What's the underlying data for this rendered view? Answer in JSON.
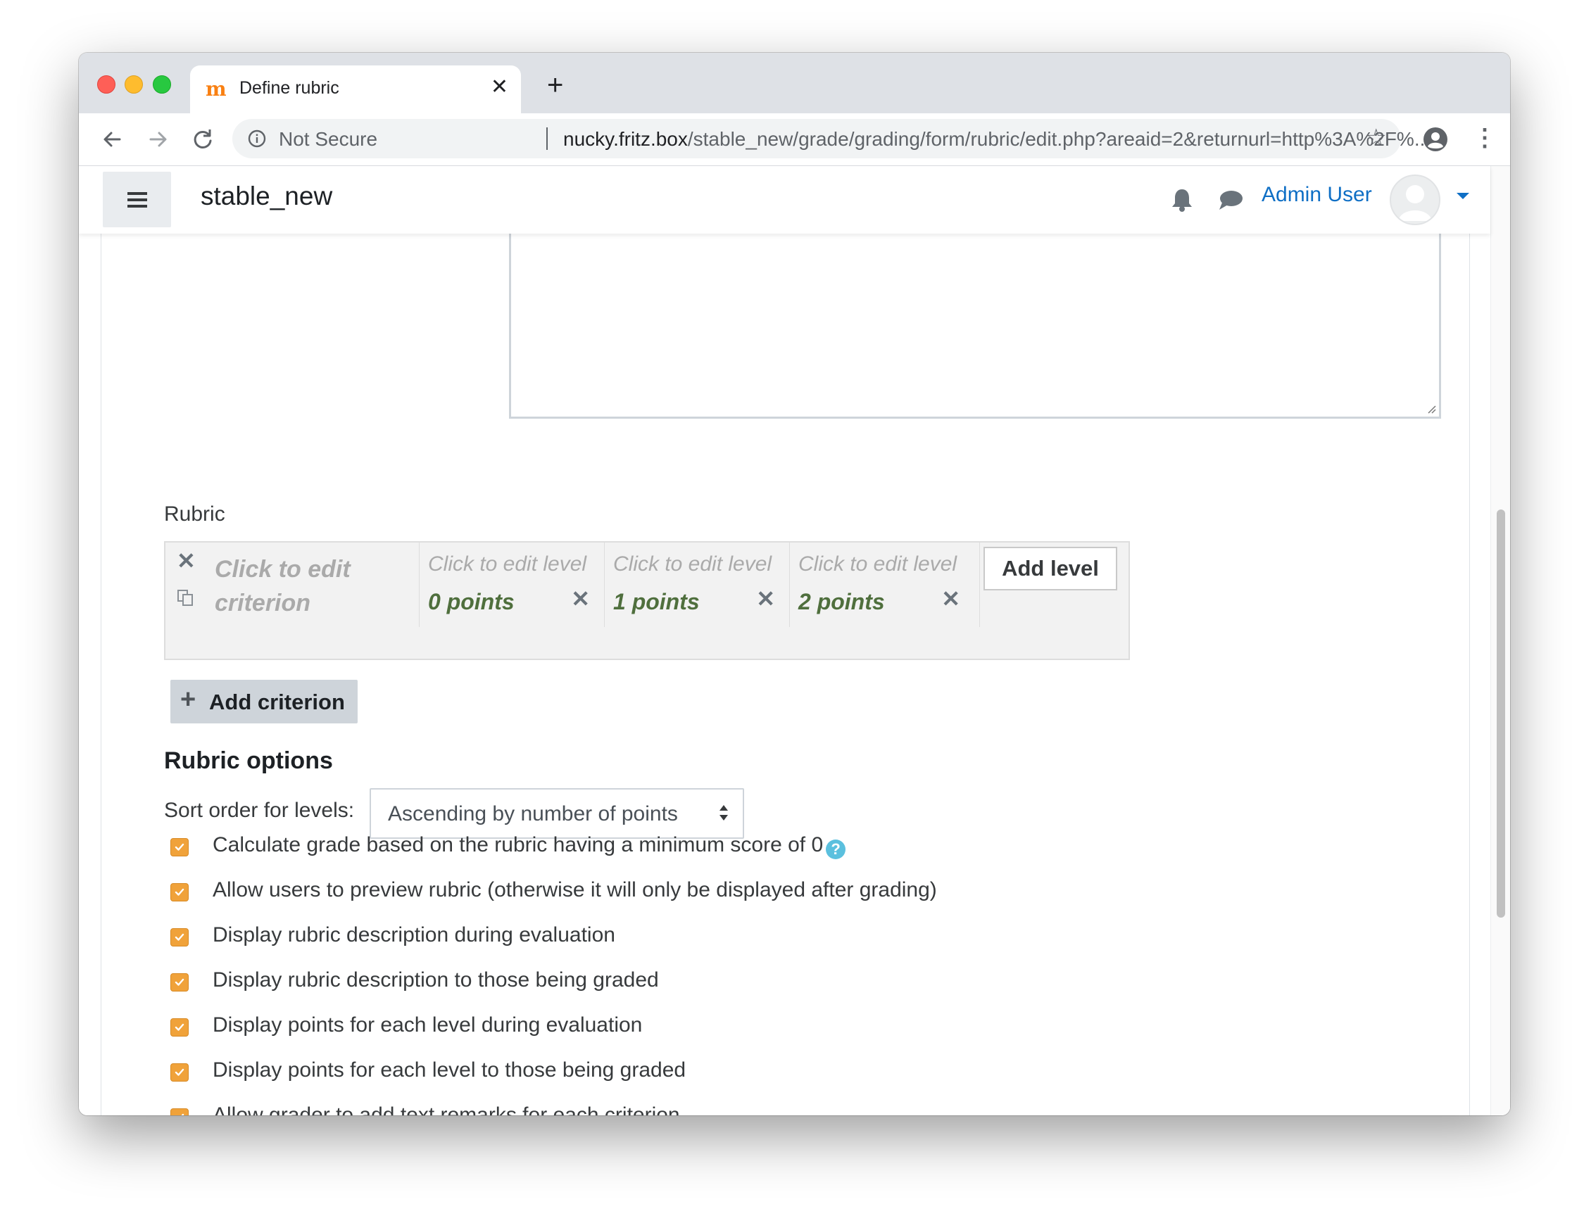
{
  "browser": {
    "tab_title": "Define rubric",
    "favicon": "m",
    "new_tab": "+",
    "not_secure": "Not Secure",
    "url_host": "nucky.fritz.box",
    "url_path": "/stable_new/grade/grading/form/rubric/edit.php?areaid=2&returnurl=http%3A%2F%..."
  },
  "navbar": {
    "site_name": "stable_new",
    "user_name": "Admin User"
  },
  "rubric": {
    "label": "Rubric",
    "criterion": {
      "description": "Click to edit criterion"
    },
    "levels": [
      {
        "definition": "Click to edit level",
        "points": "0 points"
      },
      {
        "definition": "Click to edit level",
        "points": "1 points"
      },
      {
        "definition": "Click to edit level",
        "points": "2 points"
      }
    ],
    "add_level": "Add level",
    "add_criterion": "Add criterion"
  },
  "options": {
    "heading": "Rubric options",
    "sort_label": "Sort order for levels:",
    "sort_value": "Ascending by number of points",
    "checkboxes": [
      {
        "label": "Calculate grade based on the rubric having a minimum score of 0",
        "checked": true
      },
      {
        "label": "Allow users to preview rubric (otherwise it will only be displayed after grading)",
        "checked": true
      },
      {
        "label": "Display rubric description during evaluation",
        "checked": true
      },
      {
        "label": "Display rubric description to those being graded",
        "checked": true
      },
      {
        "label": "Display points for each level during evaluation",
        "checked": true
      },
      {
        "label": "Display points for each level to those being graded",
        "checked": true
      },
      {
        "label": "Allow grader to add text remarks for each criterion",
        "checked": true
      }
    ],
    "help_glyph": "?"
  },
  "colors": {
    "accent_orange": "#f0a23a",
    "link_blue": "#0f6fc5",
    "points_green": "#4f6f3d"
  }
}
